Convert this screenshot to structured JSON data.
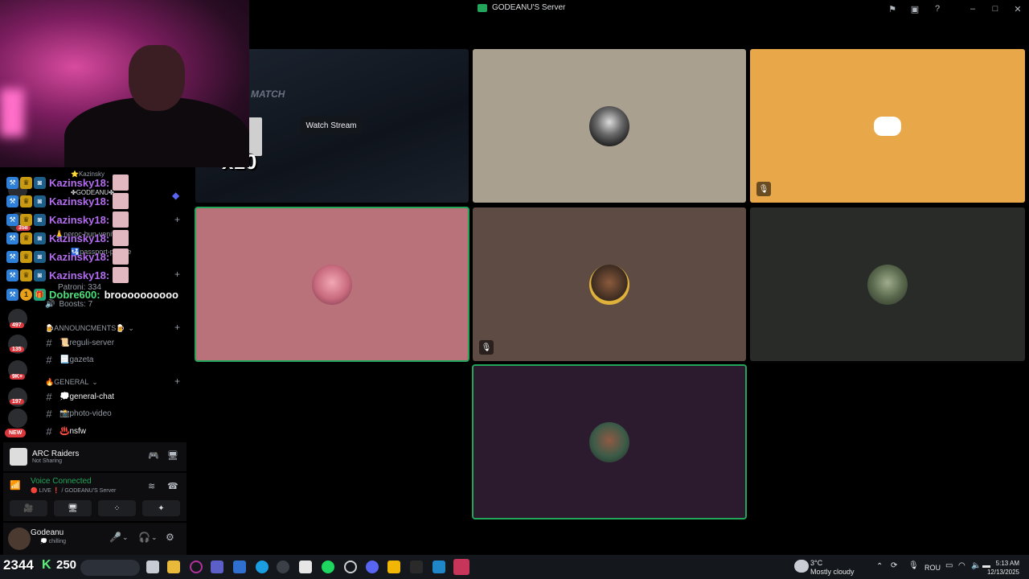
{
  "titlebar": {
    "title": "GODEANU'S Server",
    "icons": [
      "flag-icon",
      "overlay-icon",
      "help-icon",
      "minimize-icon",
      "maximize-icon",
      "close-icon"
    ]
  },
  "server": {
    "patrons": "Patroni: 334",
    "boosts": "Boosts: 7",
    "partial_rows": [
      "⭐Kazinsky",
      "✤GODEANU✤",
      "🙏noroc-bun-venit",
      "🛂passport-please"
    ]
  },
  "categories": [
    {
      "label": "🍺ANNOUNCMENTS🍺"
    },
    {
      "label": "🔥GENERAL"
    }
  ],
  "channels": [
    {
      "label": "📜reguli-server"
    },
    {
      "label": "📃gazeta"
    },
    {
      "label": "💭general-chat"
    },
    {
      "label": "📸photo-video"
    },
    {
      "label": "♨️nsfw"
    }
  ],
  "guild_badges": [
    "358",
    "497",
    "135",
    "9K+",
    "197"
  ],
  "guild_new": "NEW",
  "activity": {
    "name": "ARC Raiders",
    "status": "Not Sharing"
  },
  "voice": {
    "status": "Voice Connected",
    "location": "🔴 LIVE ❗ / GODEANU'S Server"
  },
  "user": {
    "name": "Godeanu",
    "status": "💭 chilling"
  },
  "chat": {
    "messages": [
      {
        "user": "Kazinsky18:"
      },
      {
        "user": "Kazinsky18:"
      },
      {
        "user": "Kazinsky18:"
      },
      {
        "user": "Kazinsky18:"
      },
      {
        "user": "Kazinsky18:"
      },
      {
        "user": "Kazinsky18:"
      }
    ],
    "last": {
      "user": "Dobre600:",
      "message": "broooooooooo",
      "badge": "1"
    }
  },
  "stream": {
    "watch_label": "Watch Stream",
    "game_text": "MATCH",
    "emote_combo": "x10"
  },
  "tiles": [
    {
      "bg": "#a9a08f",
      "avatar": "#2e2e2e",
      "muted": false
    },
    {
      "bg": "#e8a84a",
      "avatar": "discord",
      "muted": true
    },
    {
      "bg": "#b9727a",
      "avatar": "#d98b99",
      "muted": false,
      "speaking": true
    },
    {
      "bg": "#5e4b43",
      "avatar": "#e0b23a",
      "muted": true
    },
    {
      "bg": "#282b28",
      "avatar": "#5b6a4e",
      "muted": false
    },
    {
      "bg": "#2c1a2e",
      "avatar": "#3c5b48",
      "muted": false,
      "speaking": true
    }
  ],
  "taskbar": {
    "counter": "2344",
    "k_label": "K",
    "viewer_count": "250",
    "weather": {
      "temp": "3°C",
      "desc": "Mostly cloudy"
    },
    "language": "ROU",
    "time": "5:13 AM",
    "date": "12/13/2025"
  }
}
